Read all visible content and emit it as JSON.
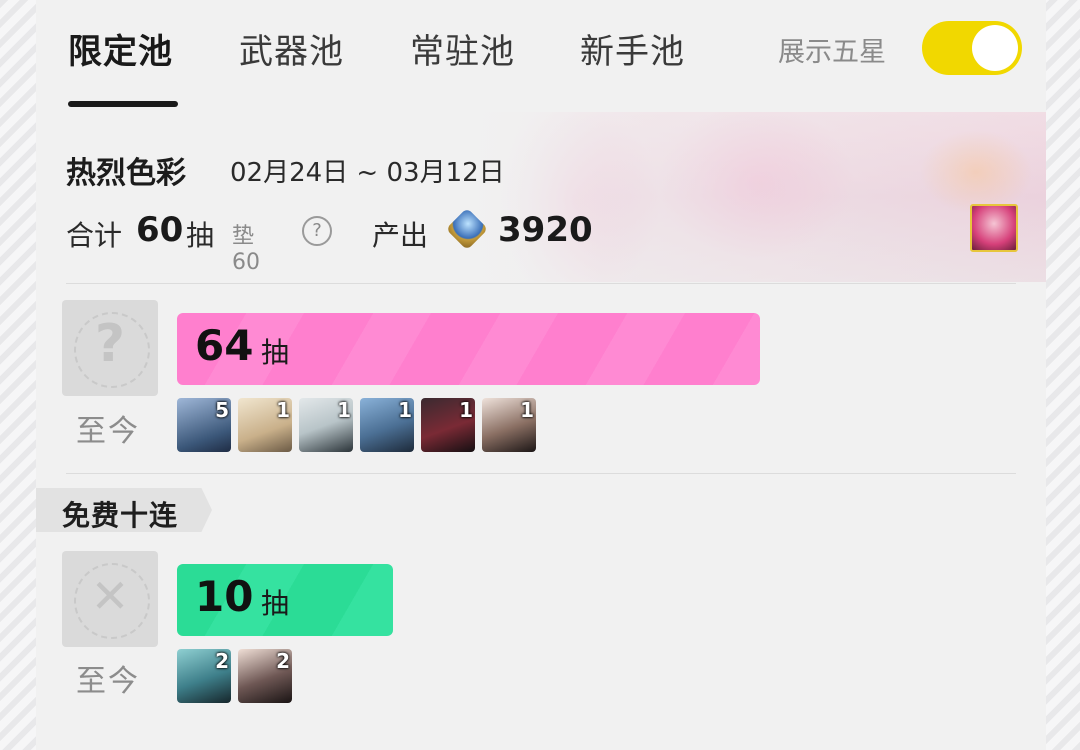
{
  "tabs": [
    {
      "label": "限定池",
      "active": true
    },
    {
      "label": "武器池",
      "active": false
    },
    {
      "label": "常驻池",
      "active": false
    },
    {
      "label": "新手池",
      "active": false
    }
  ],
  "show_five_star": {
    "label": "展示五星",
    "on": true,
    "color": "#f1d800"
  },
  "pool": {
    "name": "热烈色彩",
    "date_range": "02月24日 ~ 03月12日",
    "total_label": "合计",
    "total_pulls": "60",
    "pull_unit": "抽",
    "pity_label": "垫60",
    "help_icon": "question-circle-icon",
    "output_label": "产出",
    "output_icon": "orundum-icon",
    "output_value": "3920"
  },
  "records": [
    {
      "avatar_icon": "question-mark-icon",
      "avatar_glyph": "?",
      "since_label": "至今",
      "pulls": "64",
      "unit": "抽",
      "bar_color": "#ff7fce",
      "operators": [
        {
          "name": "operator-1",
          "count": "5"
        },
        {
          "name": "operator-2",
          "count": "1"
        },
        {
          "name": "operator-3",
          "count": "1"
        },
        {
          "name": "operator-4",
          "count": "1"
        },
        {
          "name": "operator-5",
          "count": "1"
        },
        {
          "name": "operator-6",
          "count": "1"
        }
      ]
    },
    {
      "tag_label": "免费十连",
      "avatar_icon": "close-x-icon",
      "avatar_glyph": "✕",
      "since_label": "至今",
      "pulls": "10",
      "unit": "抽",
      "bar_color": "#2bdc96",
      "operators": [
        {
          "name": "operator-7",
          "count": "2"
        },
        {
          "name": "operator-8",
          "count": "2"
        }
      ]
    }
  ]
}
